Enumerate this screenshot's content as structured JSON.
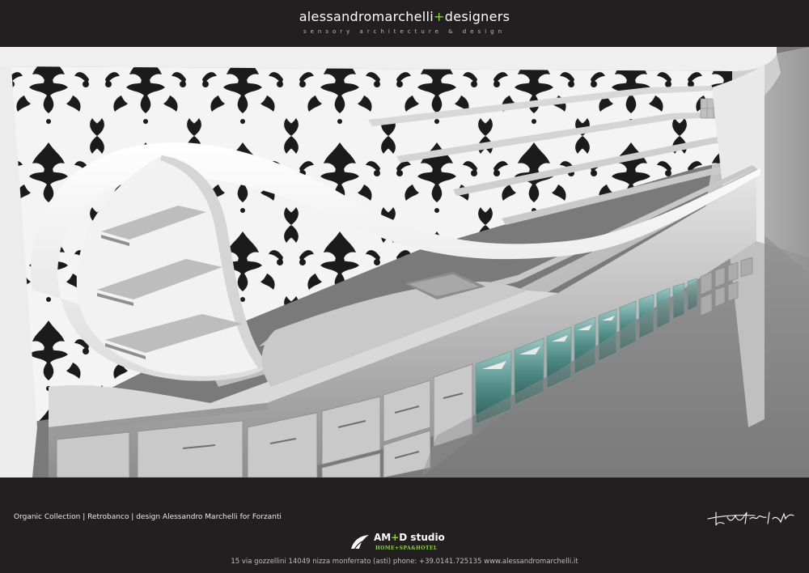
{
  "header": {
    "brand_main": "alessandromarchelli",
    "brand_plus": "+",
    "brand_tail": "designers",
    "tagline": "sensory architecture & design"
  },
  "footer": {
    "caption": "Organic Collection | Retrobanco | design Alessandro Marchelli for Forzanti",
    "logo_main": "AM",
    "logo_plus": "+",
    "logo_tail": "D studio",
    "logo_sub": "HOME+SPA&HOTEL",
    "address": "15 via gozzellini 14049 nizza monferrato (asti) phone: +39.0141.725135 www.alessandromarchelli.it"
  },
  "colors": {
    "background": "#231f20",
    "accent_green": "#8ed14f",
    "glass_tint": "#4f8b86"
  }
}
